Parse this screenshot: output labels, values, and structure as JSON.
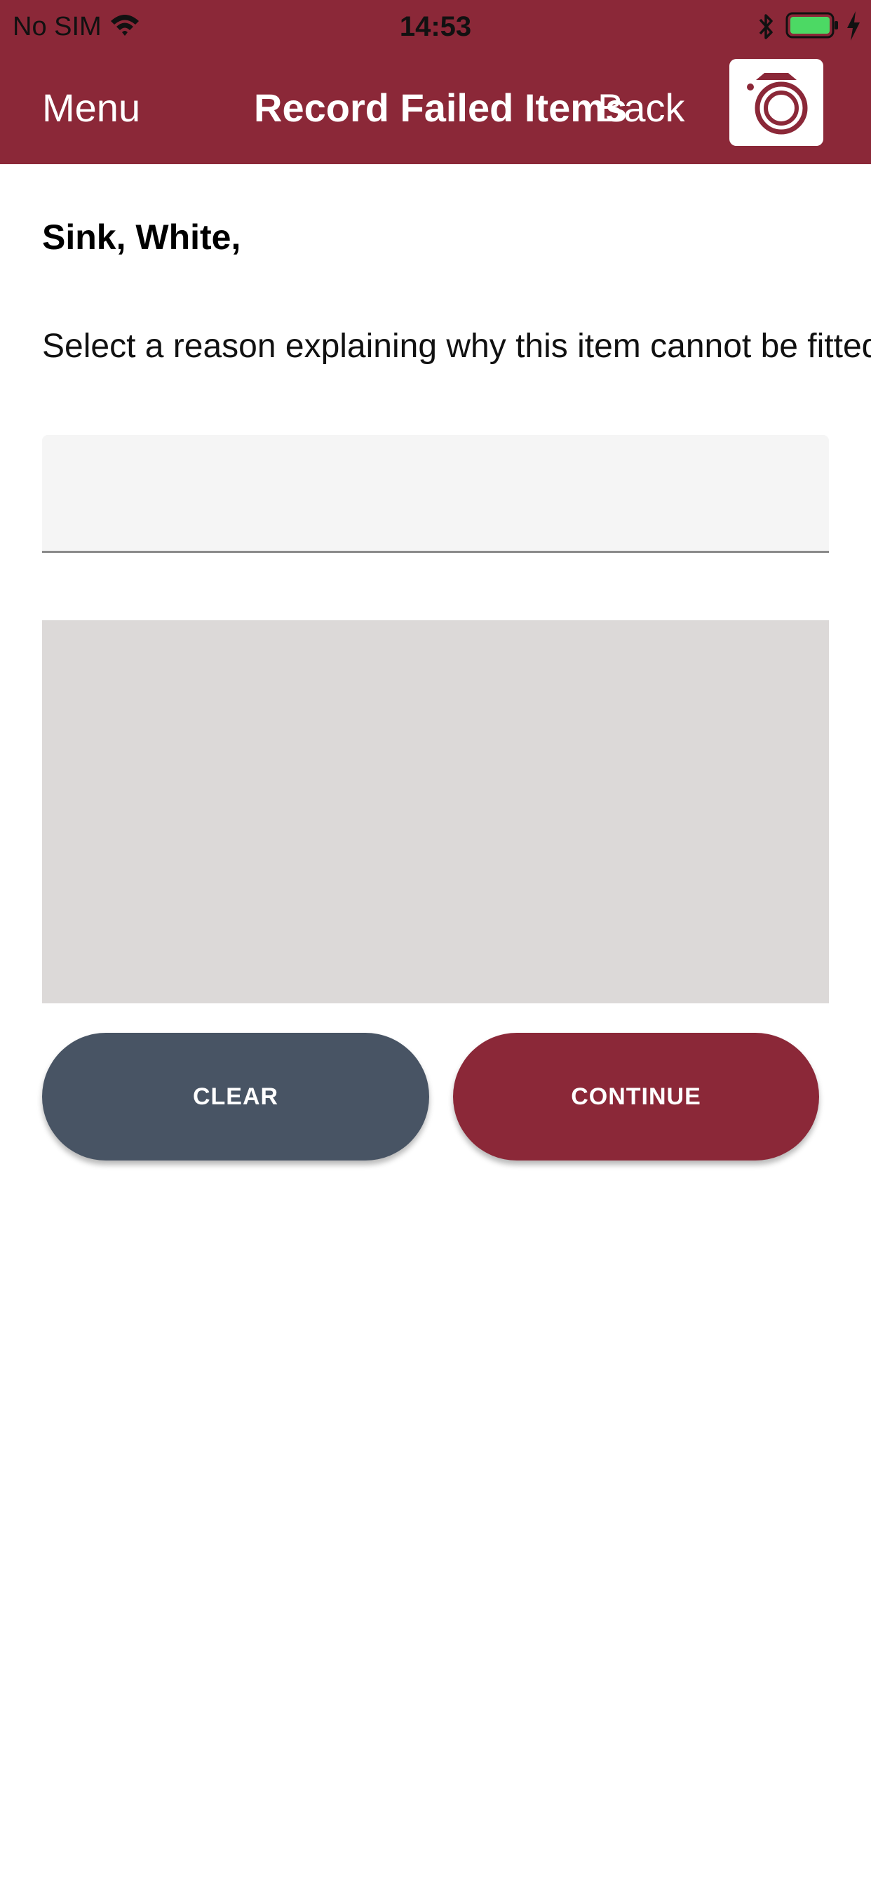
{
  "status_bar": {
    "carrier": "No SIM",
    "time": "14:53",
    "battery_color": "#4cd964",
    "wifi_icon": "wifi-icon",
    "bluetooth_icon": "bluetooth-icon",
    "charging_icon": "charging-bolt-icon"
  },
  "nav": {
    "menu_label": "Menu",
    "title": "Record Failed Items",
    "back_label": "Back",
    "camera_icon": "camera-icon"
  },
  "colors": {
    "brand": "#8b2838",
    "clear_button": "#485464",
    "signature_area": "#dcd9d8",
    "select_background": "#f5f5f5"
  },
  "content": {
    "item_name": "Sink, White,",
    "instruction": "Select a reason explaining why this item cannot be fitted",
    "reason_select_value": ""
  },
  "actions": {
    "clear_label": "CLEAR",
    "continue_label": "CONTINUE"
  }
}
